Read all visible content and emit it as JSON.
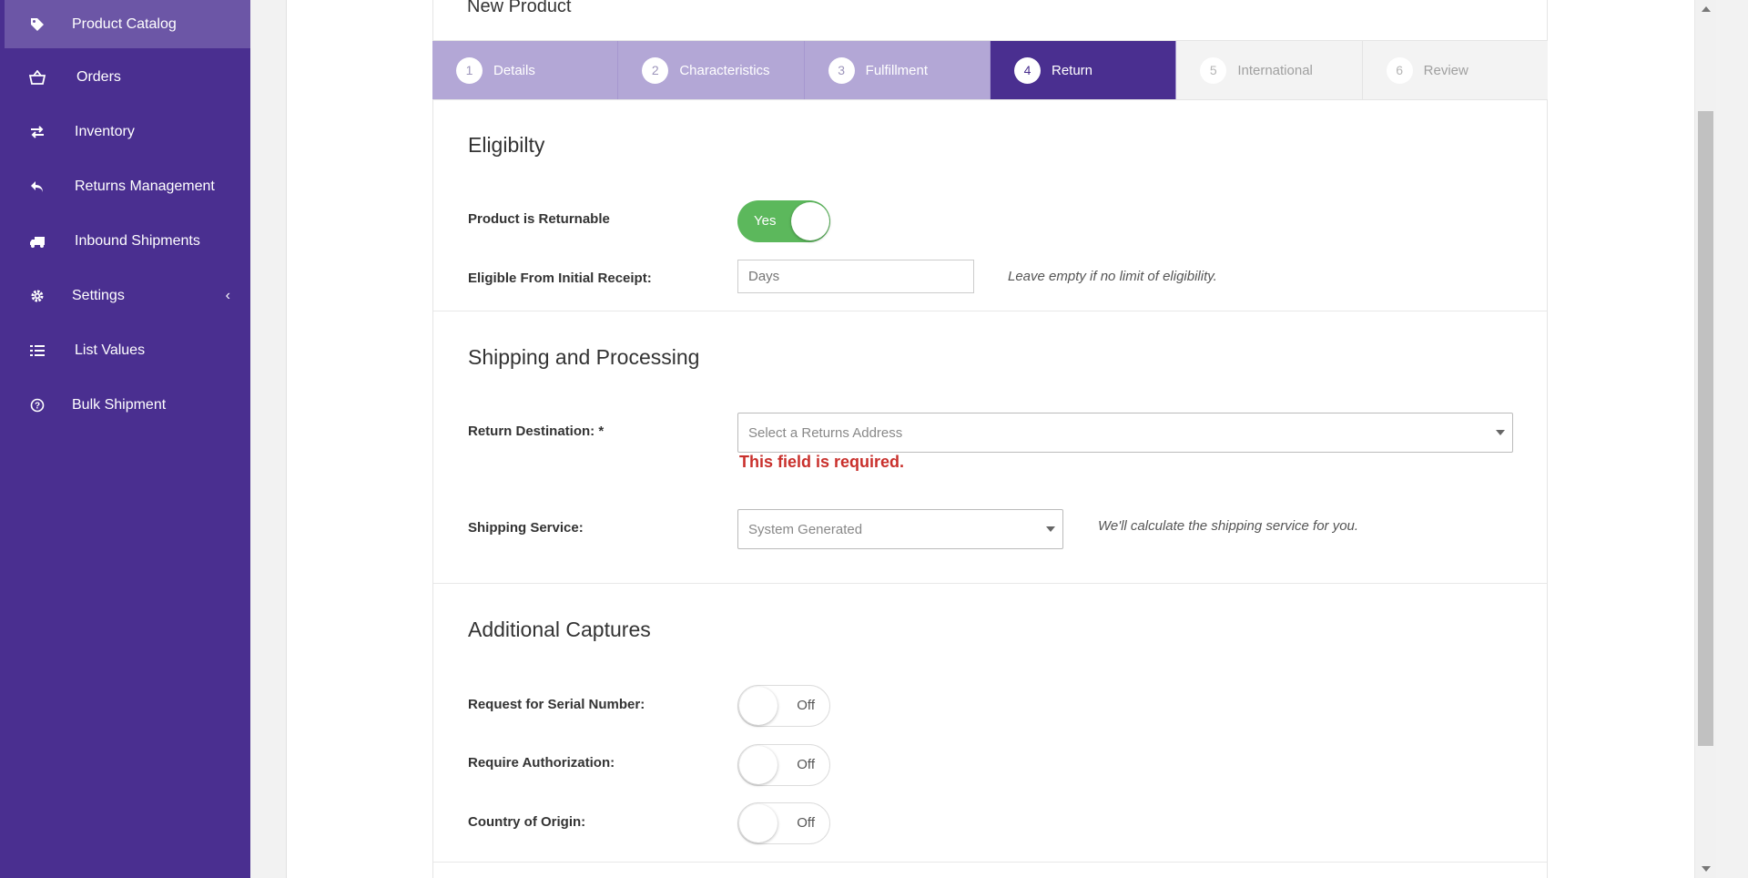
{
  "sidebar": {
    "items": [
      {
        "label": "Product Catalog",
        "icon": "tag-icon"
      },
      {
        "label": "Orders",
        "icon": "basket-icon"
      },
      {
        "label": "Inventory",
        "icon": "exchange-icon"
      },
      {
        "label": "Returns Management",
        "icon": "reply-icon"
      },
      {
        "label": "Inbound Shipments",
        "icon": "truck-icon"
      },
      {
        "label": "Settings",
        "icon": "gear-icon"
      },
      {
        "label": "List Values",
        "icon": "list-icon"
      },
      {
        "label": "Bulk Shipment",
        "icon": "question-circle-icon"
      }
    ],
    "settings_chevron": "‹",
    "colors": {
      "background": "#4a2f90",
      "active": "#6c56a6"
    }
  },
  "page": {
    "title": "New Product"
  },
  "steps": [
    {
      "number": "1",
      "label": "Details",
      "state": "done"
    },
    {
      "number": "2",
      "label": "Characteristics",
      "state": "done"
    },
    {
      "number": "3",
      "label": "Fulfillment",
      "state": "done"
    },
    {
      "number": "4",
      "label": "Return",
      "state": "active"
    },
    {
      "number": "5",
      "label": "International",
      "state": "todo"
    },
    {
      "number": "6",
      "label": "Review",
      "state": "todo"
    }
  ],
  "eligibility": {
    "title": "Eligibilty",
    "returnable_label": "Product is Returnable",
    "returnable_toggle": "Yes",
    "eligible_label": "Eligible From Initial Receipt:",
    "eligible_placeholder": "Days",
    "eligible_help": "Leave empty if no limit of eligibility."
  },
  "shipping": {
    "title": "Shipping and Processing",
    "destination_label": "Return Destination: *",
    "destination_placeholder": "Select a Returns Address",
    "destination_error": "This field is required.",
    "service_label": "Shipping Service:",
    "service_value": "System Generated",
    "service_help": "We'll calculate the shipping service for you."
  },
  "captures": {
    "title": "Additional Captures",
    "serial_label": "Request for Serial Number:",
    "serial_toggle": "Off",
    "auth_label": "Require Authorization:",
    "auth_toggle": "Off",
    "origin_label": "Country of Origin:",
    "origin_toggle": "Off"
  },
  "colors": {
    "accent": "#4a2f90",
    "step_done": "#b3a7d6",
    "toggle_on": "#5cb85c",
    "error": "#c9302c"
  }
}
